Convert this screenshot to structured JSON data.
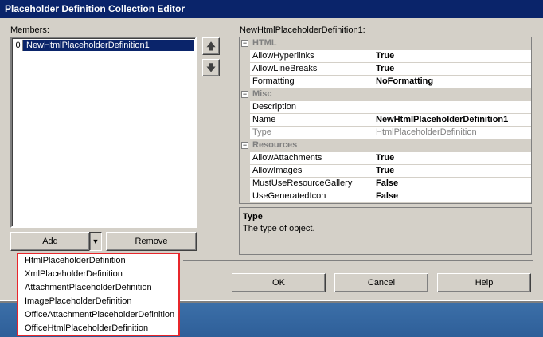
{
  "window": {
    "title": "Placeholder Definition Collection Editor"
  },
  "members": {
    "label": "Members:",
    "items": [
      {
        "index": "0",
        "name": "NewHtmlPlaceholderDefinition1",
        "selected": true
      }
    ]
  },
  "move_buttons": {
    "up_icon": "arrow-up-icon",
    "down_icon": "arrow-down-icon"
  },
  "add_button": {
    "label": "Add",
    "dropdown_icon": "chevron-down-icon"
  },
  "remove_button": {
    "label": "Remove"
  },
  "properties": {
    "title": "NewHtmlPlaceholderDefinition1:",
    "categories": [
      {
        "name": "HTML",
        "rows": [
          {
            "name": "AllowHyperlinks",
            "value": "True",
            "bold": true
          },
          {
            "name": "AllowLineBreaks",
            "value": "True",
            "bold": true
          },
          {
            "name": "Formatting",
            "value": "NoFormatting",
            "bold": true
          }
        ]
      },
      {
        "name": "Misc",
        "rows": [
          {
            "name": "Description",
            "value": "",
            "bold": false
          },
          {
            "name": "Name",
            "value": "NewHtmlPlaceholderDefinition1",
            "bold": true
          },
          {
            "name": "Type",
            "value": "HtmlPlaceholderDefinition",
            "readonly": true
          }
        ]
      },
      {
        "name": "Resources",
        "rows": [
          {
            "name": "AllowAttachments",
            "value": "True",
            "bold": true
          },
          {
            "name": "AllowImages",
            "value": "True",
            "bold": true
          },
          {
            "name": "MustUseResourceGallery",
            "value": "False",
            "bold": true
          },
          {
            "name": "UseGeneratedIcon",
            "value": "False",
            "bold": true
          }
        ]
      }
    ]
  },
  "help": {
    "title": "Type",
    "description": "The type of object."
  },
  "dialog_buttons": {
    "ok": "OK",
    "cancel": "Cancel",
    "help": "Help"
  },
  "add_menu": {
    "items": [
      "HtmlPlaceholderDefinition",
      "XmlPlaceholderDefinition",
      "AttachmentPlaceholderDefinition",
      "ImagePlaceholderDefinition",
      "OfficeAttachmentPlaceholderDefinition",
      "OfficeHtmlPlaceholderDefinition"
    ],
    "highlight_color": "#e8262b"
  },
  "colors": {
    "title_bar": "#0a246a",
    "face": "#d4d0c8",
    "selection": "#0a246a"
  }
}
